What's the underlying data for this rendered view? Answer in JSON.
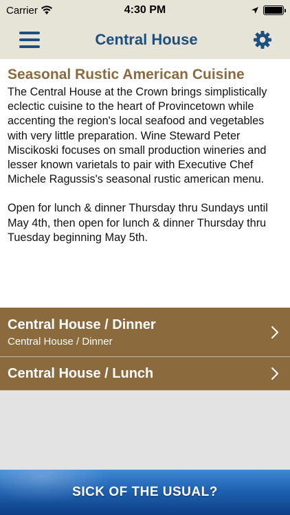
{
  "status_bar": {
    "carrier": "Carrier",
    "time": "4:30 PM"
  },
  "nav": {
    "title": "Central House",
    "menu_icon": "hamburger-menu-icon",
    "settings_icon": "gear-icon",
    "accent_color": "#1d4f7f",
    "background_color": "#e6e3d7"
  },
  "content": {
    "heading": "Seasonal Rustic American Cuisine",
    "paragraph_1": "The Central House at the Crown brings simplistically eclectic cuisine to the heart of Provincetown while accenting the region's local seafood and vegetables with very little preparation. Wine Steward Peter Miscikoski focuses on small production wineries and lesser known varietals to pair with Executive Chef Michele Ragussis's seasonal rustic american menu.",
    "paragraph_2": "Open for lunch & dinner Thursday thru Sundays until May 4th, then open for lunch & dinner Thursday thru Tuesday beginning May 5th.",
    "heading_color": "#8b6b3d"
  },
  "menu_list": {
    "row_color": "#8b6b3d",
    "items": [
      {
        "title": "Central House / Dinner",
        "subtitle": "Central House / Dinner",
        "icon": "chevron-right-icon"
      },
      {
        "title": "Central House / Lunch",
        "icon": "chevron-right-icon"
      }
    ]
  },
  "banner": {
    "text": "SICK OF THE USUAL?",
    "color": "#1f62b2"
  }
}
